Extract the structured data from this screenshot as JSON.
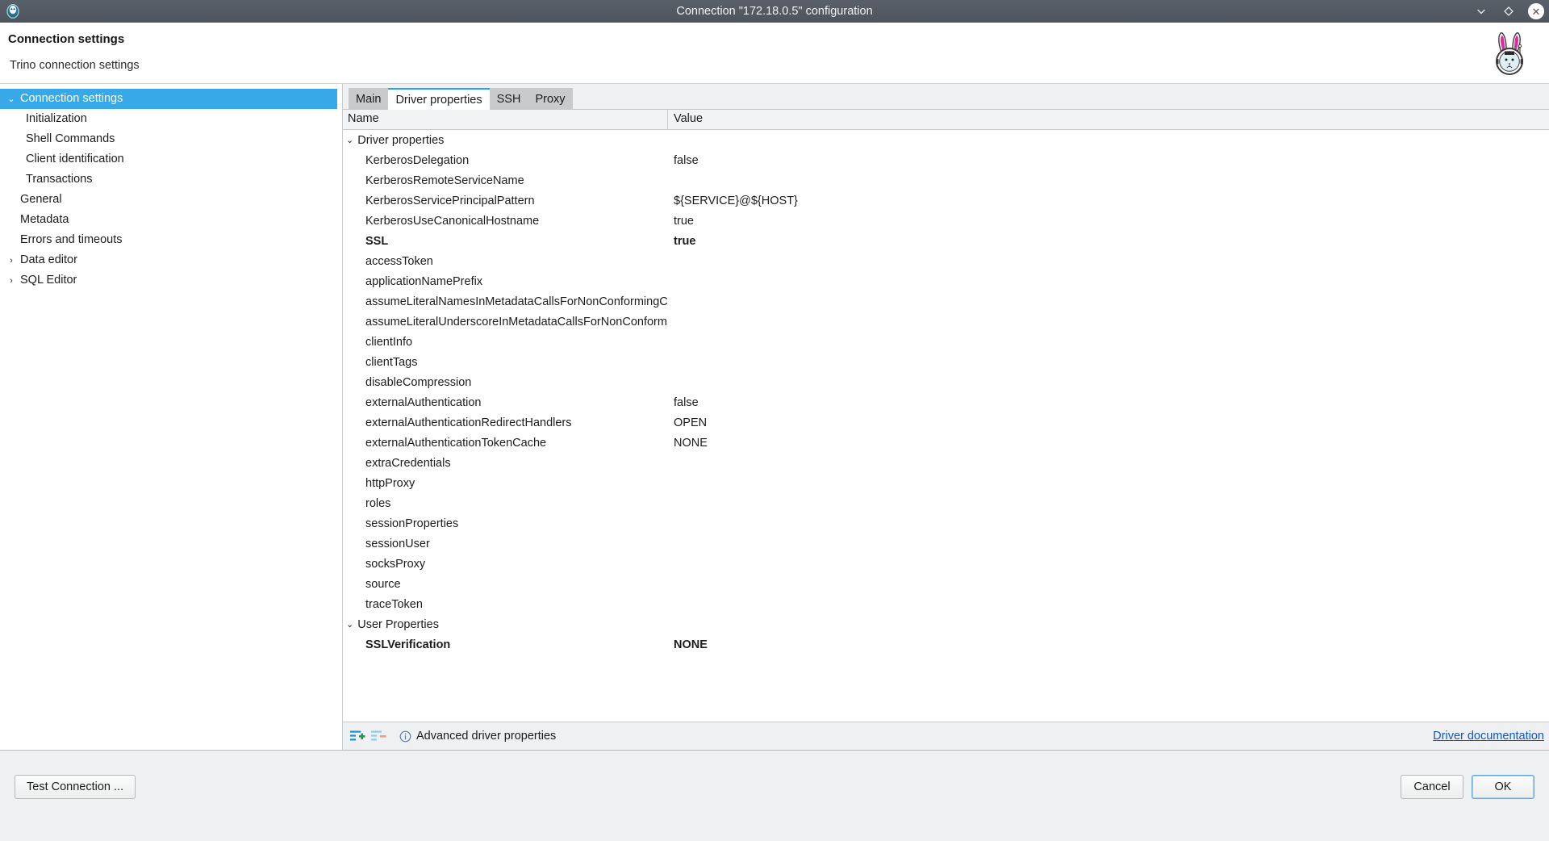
{
  "window": {
    "title": "Connection \"172.18.0.5\" configuration",
    "app_icon": "dbeaver-icon",
    "controls": {
      "minimize": "chevron-down-icon",
      "maximize": "diamond-icon",
      "close": "✕"
    }
  },
  "header": {
    "title": "Connection settings",
    "subtitle": "Trino connection settings",
    "logo": "astronaut-rabbit-logo"
  },
  "sidebar": {
    "items": [
      {
        "label": "Connection settings",
        "arrow": "⌄",
        "indent": false,
        "selected": true
      },
      {
        "label": "Initialization",
        "arrow": "",
        "indent": true,
        "selected": false
      },
      {
        "label": "Shell Commands",
        "arrow": "",
        "indent": true,
        "selected": false
      },
      {
        "label": "Client identification",
        "arrow": "",
        "indent": true,
        "selected": false
      },
      {
        "label": "Transactions",
        "arrow": "",
        "indent": true,
        "selected": false
      },
      {
        "label": "General",
        "arrow": "",
        "indent": false,
        "selected": false
      },
      {
        "label": "Metadata",
        "arrow": "",
        "indent": false,
        "selected": false
      },
      {
        "label": "Errors and timeouts",
        "arrow": "",
        "indent": false,
        "selected": false
      },
      {
        "label": "Data editor",
        "arrow": "›",
        "indent": false,
        "selected": false
      },
      {
        "label": "SQL Editor",
        "arrow": "›",
        "indent": false,
        "selected": false
      }
    ]
  },
  "tabs": [
    {
      "label": "Main",
      "active": false
    },
    {
      "label": "Driver properties",
      "active": true
    },
    {
      "label": "SSH",
      "active": false
    },
    {
      "label": "Proxy",
      "active": false
    }
  ],
  "table": {
    "columns": {
      "name": "Name",
      "value": "Value"
    },
    "rows": [
      {
        "type": "group",
        "arrow": "⌄",
        "name": "Driver properties",
        "value": "",
        "bold": false
      },
      {
        "type": "prop",
        "name": "KerberosDelegation",
        "value": "false",
        "bold": false
      },
      {
        "type": "prop",
        "name": "KerberosRemoteServiceName",
        "value": "",
        "bold": false
      },
      {
        "type": "prop",
        "name": "KerberosServicePrincipalPattern",
        "value": "${SERVICE}@${HOST}",
        "bold": false
      },
      {
        "type": "prop",
        "name": "KerberosUseCanonicalHostname",
        "value": "true",
        "bold": false
      },
      {
        "type": "prop",
        "name": "SSL",
        "value": "true",
        "bold": true
      },
      {
        "type": "prop",
        "name": "accessToken",
        "value": "",
        "bold": false
      },
      {
        "type": "prop",
        "name": "applicationNamePrefix",
        "value": "",
        "bold": false
      },
      {
        "type": "prop",
        "name": "assumeLiteralNamesInMetadataCallsForNonConformingClients",
        "value": "",
        "bold": false
      },
      {
        "type": "prop",
        "name": "assumeLiteralUnderscoreInMetadataCallsForNonConformingClients",
        "value": "",
        "bold": false
      },
      {
        "type": "prop",
        "name": "clientInfo",
        "value": "",
        "bold": false
      },
      {
        "type": "prop",
        "name": "clientTags",
        "value": "",
        "bold": false
      },
      {
        "type": "prop",
        "name": "disableCompression",
        "value": "",
        "bold": false
      },
      {
        "type": "prop",
        "name": "externalAuthentication",
        "value": "false",
        "bold": false
      },
      {
        "type": "prop",
        "name": "externalAuthenticationRedirectHandlers",
        "value": "OPEN",
        "bold": false
      },
      {
        "type": "prop",
        "name": "externalAuthenticationTokenCache",
        "value": "NONE",
        "bold": false
      },
      {
        "type": "prop",
        "name": "extraCredentials",
        "value": "",
        "bold": false
      },
      {
        "type": "prop",
        "name": "httpProxy",
        "value": "",
        "bold": false
      },
      {
        "type": "prop",
        "name": "roles",
        "value": "",
        "bold": false
      },
      {
        "type": "prop",
        "name": "sessionProperties",
        "value": "",
        "bold": false
      },
      {
        "type": "prop",
        "name": "sessionUser",
        "value": "",
        "bold": false
      },
      {
        "type": "prop",
        "name": "socksProxy",
        "value": "",
        "bold": false
      },
      {
        "type": "prop",
        "name": "source",
        "value": "",
        "bold": false
      },
      {
        "type": "prop",
        "name": "traceToken",
        "value": "",
        "bold": false
      },
      {
        "type": "group",
        "arrow": "⌄",
        "name": "User Properties",
        "value": "",
        "bold": false
      },
      {
        "type": "prop",
        "name": "SSLVerification",
        "value": "NONE",
        "bold": true
      }
    ]
  },
  "table_footer": {
    "add_icon": "add-property-icon",
    "remove_icon": "remove-property-icon",
    "info_icon": "info-icon",
    "info_text": "Advanced driver properties",
    "doc_link": "Driver documentation"
  },
  "footer": {
    "test_connection": "Test Connection ...",
    "cancel": "Cancel",
    "ok": "OK"
  },
  "colors": {
    "accent": "#37a8e8",
    "tab_accent": "#2aa3e4",
    "link": "#1155cc",
    "titlebar": "#4d545c"
  }
}
